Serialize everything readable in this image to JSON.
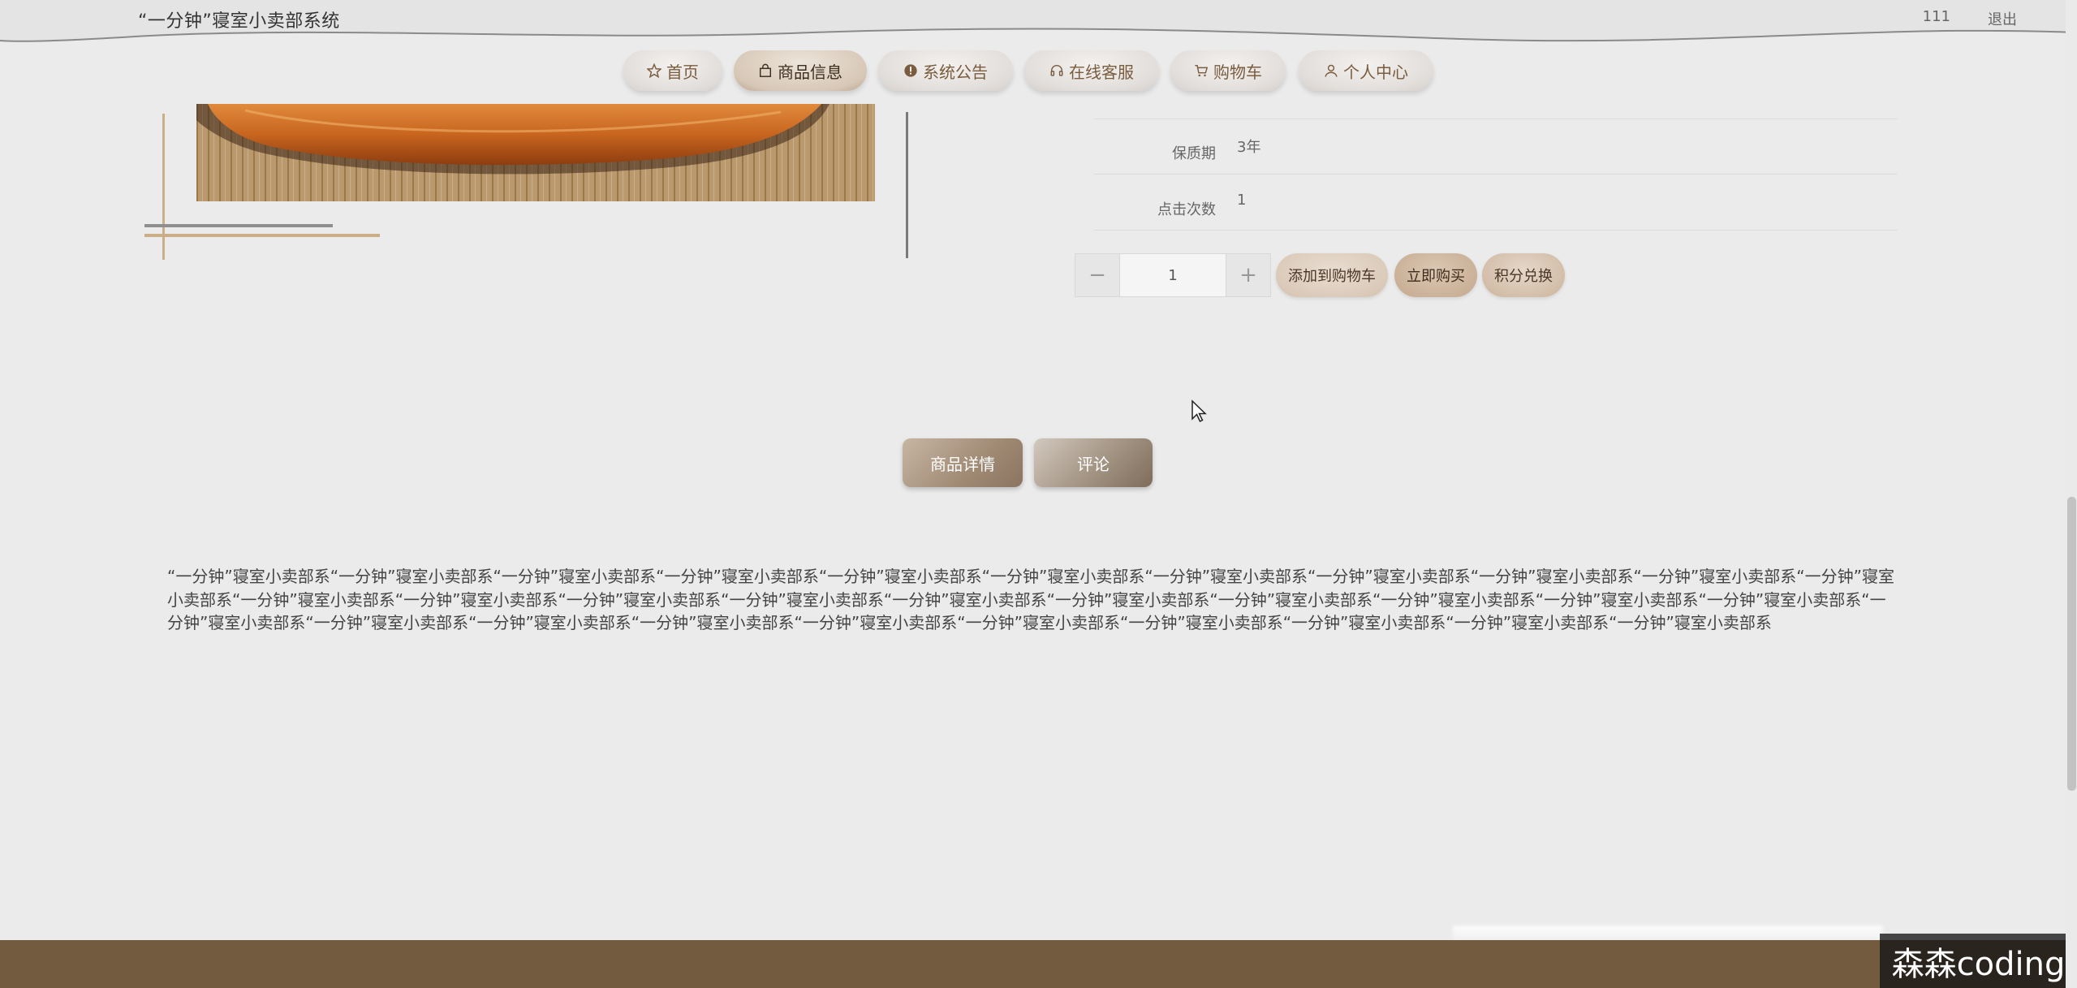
{
  "header": {
    "title": "“一分钟”寝室小卖部系统",
    "username": "111",
    "logout_label": "退出"
  },
  "nav": {
    "items": [
      {
        "label": "首页",
        "icon": "star-icon"
      },
      {
        "label": "商品信息",
        "icon": "bag-icon"
      },
      {
        "label": "系统公告",
        "icon": "alert-icon"
      },
      {
        "label": "在线客服",
        "icon": "headset-icon"
      },
      {
        "label": "购物车",
        "icon": "cart-icon"
      },
      {
        "label": "个人中心",
        "icon": "user-icon"
      }
    ],
    "active_index": 1
  },
  "product": {
    "attributes": [
      {
        "label": "保质期",
        "value": "3年"
      },
      {
        "label": "点击次数",
        "value": "1"
      }
    ],
    "quantity": "1",
    "minus_label": "−",
    "plus_label": "+",
    "add_to_cart_label": "添加到购物车",
    "buy_now_label": "立即购买",
    "points_exchange_label": "积分兑换"
  },
  "tabs": {
    "detail_label": "商品详情",
    "comment_label": "评论"
  },
  "description": "“一分钟”寝室小卖部系“一分钟”寝室小卖部系“一分钟”寝室小卖部系“一分钟”寝室小卖部系“一分钟”寝室小卖部系“一分钟”寝室小卖部系“一分钟”寝室小卖部系“一分钟”寝室小卖部系“一分钟”寝室小卖部系“一分钟”寝室小卖部系“一分钟”寝室小卖部系“一分钟”寝室小卖部系“一分钟”寝室小卖部系“一分钟”寝室小卖部系“一分钟”寝室小卖部系“一分钟”寝室小卖部系“一分钟”寝室小卖部系“一分钟”寝室小卖部系“一分钟”寝室小卖部系“一分钟”寝室小卖部系“一分钟”寝室小卖部系“一分钟”寝室小卖部系“一分钟”寝室小卖部系“一分钟”寝室小卖部系“一分钟”寝室小卖部系“一分钟”寝室小卖部系“一分钟”寝室小卖部系“一分钟”寝室小卖部系“一分钟”寝室小卖部系“一分钟”寝室小卖部系“一分钟”寝室小卖部系",
  "watermark": "森森coding",
  "colors": {
    "background": "#ebebeb",
    "footer": "#735b3f",
    "accent_brown": "#a08a74"
  }
}
